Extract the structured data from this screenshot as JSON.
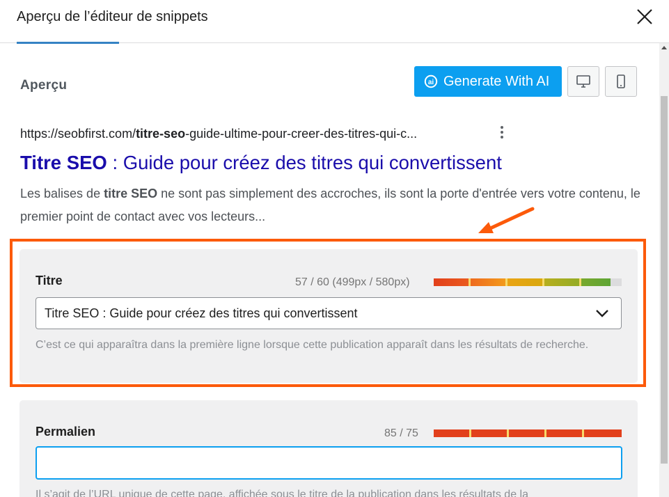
{
  "header": {
    "title": "Aperçu de l’éditeur de snippets",
    "close_icon": "close-icon"
  },
  "preview": {
    "label": "Aperçu",
    "ai_button_label": "Generate With AI",
    "ai_icon": "ai-icon",
    "desktop_icon": "desktop-icon",
    "mobile_icon": "mobile-icon",
    "accent_color": "#0c9ff0"
  },
  "serp": {
    "url_prefix": "https://seobfirst.com/",
    "url_bold": "titre-seo",
    "url_suffix": "-guide-ultime-pour-creer-des-titres-qui-c...",
    "title_bold": "Titre SEO",
    "title_rest": " : Guide pour créez des titres qui convertissent",
    "desc_prefix": "Les balises de ",
    "desc_bold": "titre SEO",
    "desc_rest": " ne sont pas simplement des accroches, ils sont la porte d'entrée vers votre contenu, le premier point de contact avec vos lecteurs...",
    "link_color": "#1a0dab"
  },
  "annotation": {
    "color": "#fc5a0a"
  },
  "title_field": {
    "label": "Titre",
    "counter": "57 / 60 (499px / 580px)",
    "meter_fraction": 0.95,
    "value": "Titre SEO : Guide pour créez des titres qui convertissent",
    "help": "C’est ce qui apparaîtra dans la première ligne lorsque cette publication apparaît dans les résultats de recherche."
  },
  "permalink_field": {
    "label": "Permalien",
    "counter": "85 / 75",
    "meter_fraction": 1.0,
    "value": "",
    "meter_color": "#e2401c",
    "help": "Il s’agit de l’URL unique de cette page, affichée sous le titre de la publication dans les résultats de la"
  }
}
